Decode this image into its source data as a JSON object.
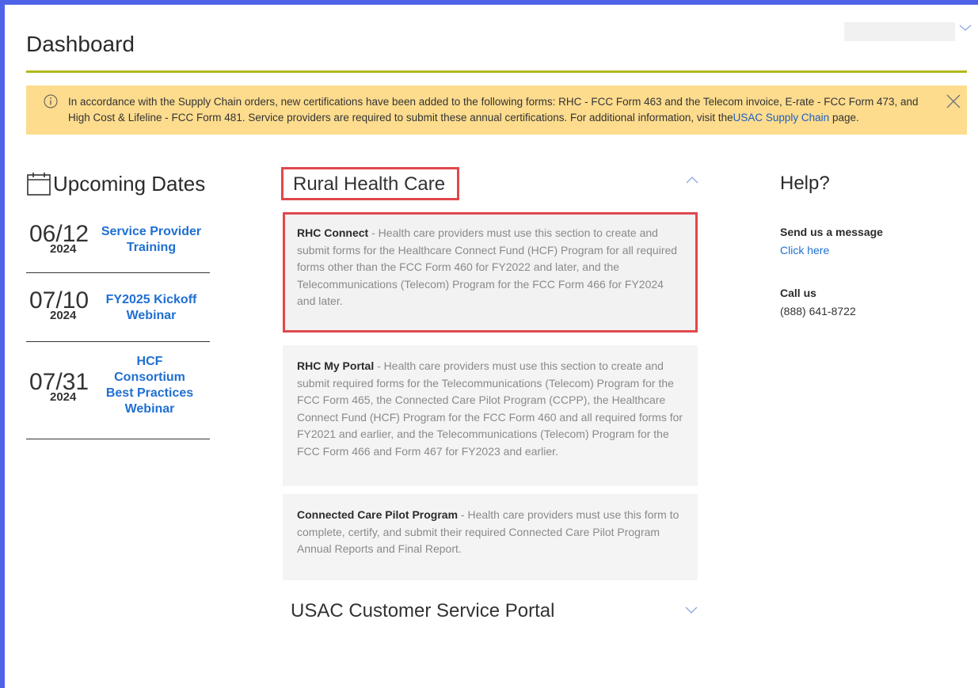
{
  "page": {
    "title": "Dashboard"
  },
  "alert": {
    "text_before": "In accordance with the Supply Chain orders, new certifications have been added to the following forms: RHC - FCC Form 463 and the Telecom invoice, E-rate - FCC Form 473, and High Cost & Lifeline - FCC Form 481. Service providers are required to submit these annual certifications. For additional information, visit the",
    "link_text": "USAC Supply Chain",
    "text_after": " page.",
    "background": "#fddc8e",
    "link_color": "#1f5fbf"
  },
  "upcoming": {
    "title": "Upcoming Dates",
    "items": [
      {
        "month_day": "06/12",
        "year": "2024",
        "event": "Service Provider Training"
      },
      {
        "month_day": "07/10",
        "year": "2024",
        "event": "FY2025 Kickoff Webinar"
      },
      {
        "month_day": "07/31",
        "year": "2024",
        "event": "HCF Consortium Best Practices Webinar"
      }
    ]
  },
  "rhc": {
    "title": "Rural Health Care",
    "cards": [
      {
        "name": "RHC Connect",
        "description": " - Health care providers must use this section to create and submit forms for the Healthcare Connect Fund (HCF) Program for all required forms other than the FCC Form 460 for FY2022 and later, and the Telecommunications (Telecom) Program for the FCC Form 466 for FY2024 and later."
      },
      {
        "name": "RHC My Portal",
        "description": " - Health care providers must use this section to create and submit required forms for the Telecommunications (Telecom) Program for the FCC Form 465, the Connected Care Pilot Program (CCPP), the Healthcare Connect Fund (HCF) Program for the FCC Form 460 and all required forms for FY2021 and earlier, and the Telecommunications (Telecom) Program for the FCC Form 466 and Form 467 for FY2023 and earlier."
      },
      {
        "name": "Connected Care Pilot Program",
        "description": " - Health care providers must use this form to complete, certify, and submit their required Connected Care Pilot Program Annual Reports and Final Report."
      }
    ]
  },
  "portal": {
    "title": "USAC Customer Service Portal"
  },
  "help": {
    "title": "Help?",
    "message_label": "Send us a message",
    "message_link": "Click here",
    "call_label": "Call us",
    "phone": "(888) 641-8722"
  },
  "colors": {
    "accent_rule": "#b2b91b",
    "link": "#1f6fd1",
    "highlight_border": "#e0484c",
    "frame": "#4f63e8"
  },
  "icons": {
    "alert": "info-circle-icon",
    "close": "close-icon",
    "calendar": "calendar-icon",
    "collapse": "chevron-up-icon",
    "expand": "chevron-down-icon"
  }
}
